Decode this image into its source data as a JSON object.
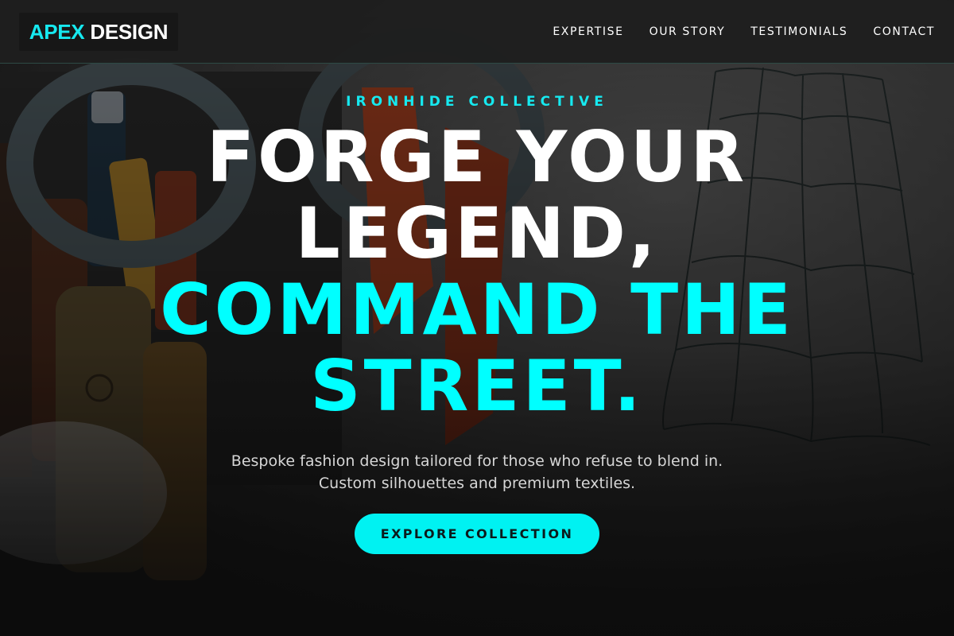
{
  "brand": {
    "name_part1": "APEX",
    "name_part2": "DESIGN",
    "accent_color": "#16e9f0"
  },
  "nav": {
    "items": [
      {
        "label": "EXPERTISE"
      },
      {
        "label": "OUR STORY"
      },
      {
        "label": "TESTIMONIALS"
      },
      {
        "label": "CONTACT"
      }
    ]
  },
  "hero": {
    "eyebrow": "IRONHIDE COLLECTIVE",
    "headline": {
      "line1": "FORGE YOUR",
      "line2": "LEGEND,",
      "line3": "COMMAND THE",
      "line4": "STREET."
    },
    "subtitle": {
      "line1": "Bespoke fashion design tailored for those who refuse to blend in.",
      "line2": "Custom silhouettes and premium textiles."
    },
    "cta_label": "EXPLORE COLLECTION"
  },
  "colors": {
    "accent": "#00ffff",
    "header_bg": "#1e1e1e",
    "text_primary": "#ffffff"
  },
  "icons": {
    "background": "atelier-tools-photo"
  }
}
